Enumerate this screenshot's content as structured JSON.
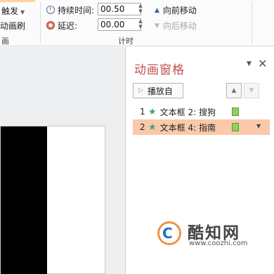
{
  "ribbon": {
    "trigger_label": "触发",
    "painter_label": "动画刷",
    "group_left_label": "画",
    "duration_label": "持续时间:",
    "duration_value": "00.50",
    "delay_label": "延迟:",
    "delay_value": "00.00",
    "timing_group_label": "计时",
    "move_forward_label": "向前移动",
    "move_backward_label": "向后移动"
  },
  "pane": {
    "title": "动画窗格",
    "play_label": "播放自",
    "items": [
      {
        "num": "1",
        "label": "文本框 2: 搜狗",
        "selected": false
      },
      {
        "num": "2",
        "label": "文本框 4: 指南",
        "selected": true
      }
    ]
  },
  "watermark": {
    "logo_letter": "C",
    "name": "酷知网",
    "url": "www.coozhi.com"
  },
  "colors": {
    "pane_title": "#c0504d",
    "selected_row": "#f9c9a9",
    "timing_bar": "#8fd063",
    "star": "#4f9a86"
  },
  "icons": [
    "clock-icon",
    "delay-icon",
    "play-icon",
    "move-up-icon",
    "move-down-icon",
    "star-icon",
    "close-icon",
    "pane-menu-icon",
    "chevron-down-icon"
  ]
}
